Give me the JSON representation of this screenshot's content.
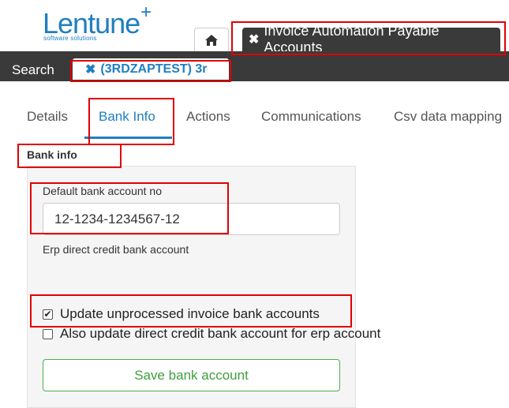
{
  "logo": {
    "name": "Lentune",
    "plus": "+",
    "tagline": "software solutions"
  },
  "tabs": {
    "home_icon": "home-icon",
    "document_tab": {
      "close": "✖",
      "label": "Invoice Automation Payable Accounts"
    }
  },
  "topbar": {
    "search_label": "Search",
    "record_tab": {
      "close": "✖",
      "label": "(3RDZAPTEST) 3r"
    }
  },
  "subtabs": [
    {
      "label": "Details"
    },
    {
      "label": "Bank Info"
    },
    {
      "label": "Actions"
    },
    {
      "label": "Communications"
    },
    {
      "label": "Csv data mapping"
    }
  ],
  "bank_info": {
    "section_label": "Bank info",
    "default_account_label": "Default bank account no",
    "default_account_value": "12-1234-1234567-12",
    "erp_direct_credit_label": "Erp direct credit bank account",
    "update_unprocessed": {
      "label": "Update unprocessed invoice bank accounts",
      "checked": true
    },
    "also_update_direct": {
      "label": "Also update direct credit bank account for erp account",
      "checked": false
    },
    "save_button": "Save bank account"
  },
  "colors": {
    "brand": "#1f7fc0",
    "dark_bar": "#3a3a3a",
    "success": "#3f9e3f",
    "highlight": "#e00000"
  }
}
